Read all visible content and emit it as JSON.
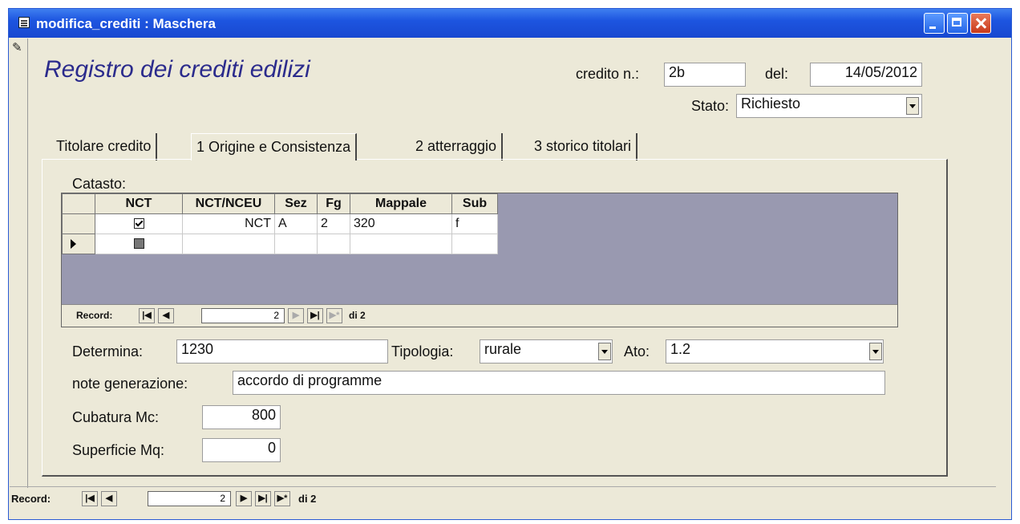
{
  "window": {
    "title": "modifica_crediti : Maschera"
  },
  "form": {
    "title": "Registro dei crediti edilizi",
    "credito_label": "credito n.:",
    "credito_value": "2b",
    "del_label": "del:",
    "del_value": "14/05/2012",
    "stato_label": "Stato:",
    "stato_value": "Richiesto"
  },
  "tabs": [
    {
      "label": "Titolare credito"
    },
    {
      "label": "1 Origine e Consistenza"
    },
    {
      "label": "2 atterraggio"
    },
    {
      "label": "3 storico titolari"
    }
  ],
  "catasto": {
    "label": "Catasto:",
    "columns": [
      "NCT",
      "NCT/NCEU",
      "Sez",
      "Fg",
      "Mappale",
      "Sub"
    ],
    "rows": [
      {
        "nct_checked": true,
        "nct_nceu": "NCT",
        "sez": "A",
        "fg": "2",
        "mappale": "320",
        "sub": "f"
      }
    ],
    "nav": {
      "label": "Record:",
      "current": "2",
      "total": "di 2"
    }
  },
  "fields": {
    "determina_label": "Determina:",
    "determina_value": "1230",
    "tipologia_label": "Tipologia:",
    "tipologia_value": "rurale",
    "ato_label": "Ato:",
    "ato_value": "1.2",
    "note_label": "note generazione:",
    "note_value": "accordo di programme",
    "cubatura_label": "Cubatura Mc:",
    "cubatura_value": "800",
    "superficie_label": "Superficie Mq:",
    "superficie_value": "0"
  },
  "main_nav": {
    "label": "Record:",
    "current": "2",
    "total": "di 2"
  }
}
